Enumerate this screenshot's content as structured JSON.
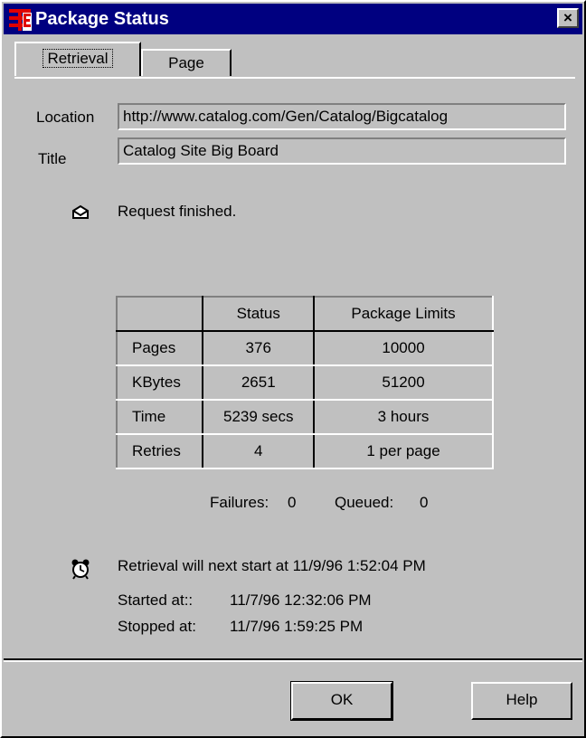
{
  "window": {
    "title": "Package Status",
    "close_label": "×"
  },
  "tabs": [
    {
      "label": "Retrieval"
    },
    {
      "label": "Page"
    }
  ],
  "location": {
    "label": "Location",
    "value": "http://www.catalog.com/Gen/Catalog/Bigcatalog"
  },
  "title_field": {
    "label": "Title",
    "value": "Catalog Site Big Board"
  },
  "request_status": {
    "icon": "envelope-icon",
    "text": "Request finished."
  },
  "stats_table": {
    "headers": [
      "",
      "Status",
      "Package Limits"
    ],
    "rows": [
      {
        "label": "Pages",
        "status": "376",
        "limit": "10000"
      },
      {
        "label": "KBytes",
        "status": "2651",
        "limit": "51200"
      },
      {
        "label": "Time",
        "status": "5239 secs",
        "limit": "3 hours"
      },
      {
        "label": "Retries",
        "status": "4",
        "limit": "1 per page"
      }
    ]
  },
  "failures": {
    "label": "Failures:",
    "value": "0"
  },
  "queued": {
    "label": "Queued:",
    "value": "0"
  },
  "schedule": {
    "icon": "alarm-clock-icon",
    "next_start": "Retrieval will next start at 11/9/96 1:52:04 PM",
    "started_label": "Started at::",
    "started_value": "11/7/96 12:32:06 PM",
    "stopped_label": "Stopped at:",
    "stopped_value": "11/7/96 1:59:25 PM"
  },
  "buttons": {
    "ok": "OK",
    "help": "Help"
  },
  "colors": {
    "titlebar": "#000080",
    "face": "#c0c0c0",
    "app_icon": "#e00000"
  }
}
